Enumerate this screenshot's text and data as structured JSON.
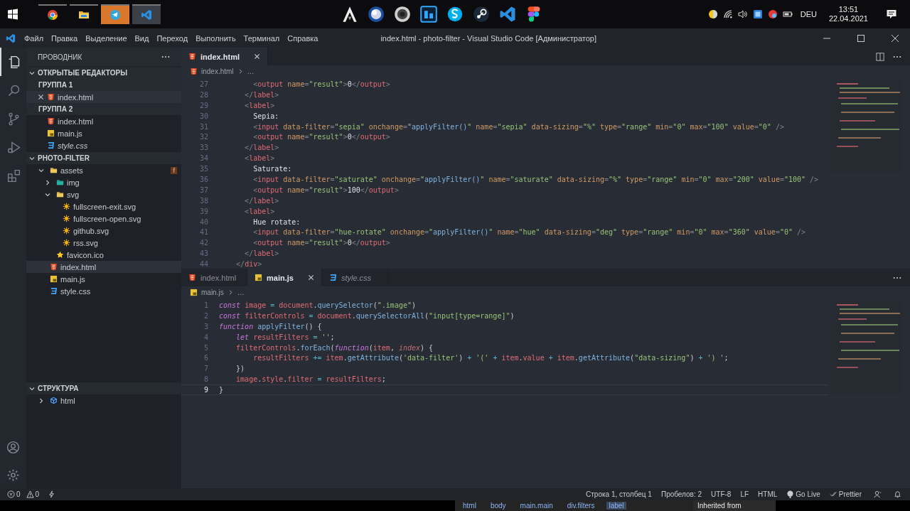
{
  "taskbar": {
    "left_apps": [
      {
        "kind": "start"
      },
      {
        "kind": "browser",
        "running": true,
        "attention": false,
        "active": false
      },
      {
        "kind": "folder",
        "running": true,
        "attention": false,
        "active": false
      },
      {
        "kind": "plane",
        "running": true,
        "attention": true,
        "active": false
      },
      {
        "kind": "editor",
        "running": true,
        "attention": false,
        "active": true
      }
    ],
    "pinned_apps": [
      {
        "kind": "peak"
      },
      {
        "kind": "sphere"
      },
      {
        "kind": "disc"
      },
      {
        "kind": "square"
      },
      {
        "kind": "bubble"
      },
      {
        "kind": "knob"
      },
      {
        "kind": "editor"
      },
      {
        "kind": "shapes"
      }
    ],
    "tray": {
      "icons": [
        {
          "kind": "weather"
        },
        {
          "kind": "wifi"
        },
        {
          "kind": "volume"
        },
        {
          "kind": "app"
        },
        {
          "kind": "ball"
        },
        {
          "kind": "battery"
        }
      ],
      "language": "DEU",
      "time": "13:51",
      "date": "22.04.2021"
    }
  },
  "window": {
    "menu": [
      "Файл",
      "Правка",
      "Выделение",
      "Вид",
      "Переход",
      "Выполнить",
      "Терминал",
      "Справка"
    ],
    "title": "index.html - photo-filter - Visual Studio Code [Администратор]"
  },
  "activity_bar": [
    {
      "kind": "explorer",
      "selected": true
    },
    {
      "kind": "search",
      "selected": false
    },
    {
      "kind": "source-control",
      "selected": false
    },
    {
      "kind": "run",
      "selected": false
    },
    {
      "kind": "extensions",
      "selected": false
    }
  ],
  "sidebar": {
    "title": "ПРОВОДНИК",
    "sections": [
      {
        "kind": "open-editors",
        "title": "ОТКРЫТЫЕ РЕДАКТОРЫ",
        "expanded": true,
        "groups": [
          {
            "title": "ГРУППА 1",
            "files": [
              {
                "name": "index.html",
                "kind": "html",
                "selected": true,
                "closable": true,
                "preview": false
              }
            ]
          },
          {
            "title": "ГРУППА 2",
            "files": [
              {
                "name": "index.html",
                "kind": "html",
                "selected": false,
                "closable": false,
                "preview": false
              },
              {
                "name": "main.js",
                "kind": "js",
                "selected": false,
                "closable": false,
                "preview": false
              },
              {
                "name": "style.css",
                "kind": "css",
                "selected": false,
                "closable": false,
                "preview": true
              }
            ]
          }
        ]
      },
      {
        "kind": "tree",
        "title": "PHOTO-FILTER",
        "expanded": true,
        "items": [
          {
            "name": "assets",
            "kind": "folder",
            "expanded": true,
            "selected": false,
            "badge": "f",
            "children": [
              {
                "name": "img",
                "kind": "image-folder",
                "expanded": false,
                "selected": false
              },
              {
                "name": "svg",
                "kind": "folder",
                "expanded": true,
                "selected": false,
                "children": [
                  {
                    "name": "fullscreen-exit.svg",
                    "kind": "svg",
                    "selected": false
                  },
                  {
                    "name": "fullscreen-open.svg",
                    "kind": "svg",
                    "selected": false
                  },
                  {
                    "name": "github.svg",
                    "kind": "svg",
                    "selected": false
                  },
                  {
                    "name": "rss.svg",
                    "kind": "svg",
                    "selected": false
                  }
                ]
              },
              {
                "name": "favicon.ico",
                "kind": "ico",
                "selected": false
              }
            ]
          },
          {
            "name": "index.html",
            "kind": "html",
            "selected": true
          },
          {
            "name": "main.js",
            "kind": "js",
            "selected": false
          },
          {
            "name": "style.css",
            "kind": "css",
            "selected": false
          }
        ]
      },
      {
        "kind": "outline",
        "title": "СТРУКТУРА",
        "expanded": true,
        "items": [
          {
            "name": "html",
            "kind": "element",
            "expanded": false,
            "selected": false
          }
        ]
      }
    ]
  },
  "editor_groups": [
    {
      "tabs": [
        {
          "name": "index.html",
          "kind": "html",
          "selected": true,
          "preview": false
        }
      ],
      "breadcrumb": {
        "file": "index.html",
        "kind": "html",
        "rest": "…"
      },
      "lines": [
        {
          "number": "27",
          "current": false,
          "tokens": [
            {
              "kind": "bracket",
              "t": "        <"
            },
            {
              "kind": "tag",
              "t": "output"
            },
            {
              "kind": "attr",
              "t": " name"
            },
            {
              "kind": "bracket",
              "t": "="
            },
            {
              "kind": "string",
              "t": "\"result\""
            },
            {
              "kind": "bracket",
              "t": ">"
            },
            {
              "kind": "text",
              "t": "0"
            },
            {
              "kind": "bracket",
              "t": "</"
            },
            {
              "kind": "tag",
              "t": "output"
            },
            {
              "kind": "bracket",
              "t": ">"
            }
          ]
        },
        {
          "number": "28",
          "current": false,
          "tokens": [
            {
              "kind": "bracket",
              "t": "      </"
            },
            {
              "kind": "tag",
              "t": "label"
            },
            {
              "kind": "bracket",
              "t": ">"
            }
          ]
        },
        {
          "number": "29",
          "current": false,
          "tokens": [
            {
              "kind": "bracket",
              "t": "      <"
            },
            {
              "kind": "tag",
              "t": "label"
            },
            {
              "kind": "bracket",
              "t": ">"
            }
          ]
        },
        {
          "number": "30",
          "current": false,
          "tokens": [
            {
              "kind": "text",
              "t": "        Sepia:"
            }
          ]
        },
        {
          "number": "31",
          "current": false,
          "tokens": [
            {
              "kind": "bracket",
              "t": "        <"
            },
            {
              "kind": "tag",
              "t": "input"
            },
            {
              "kind": "attr",
              "t": " data-filter"
            },
            {
              "kind": "bracket",
              "t": "="
            },
            {
              "kind": "string",
              "t": "\"sepia\""
            },
            {
              "kind": "attr",
              "t": " onchange"
            },
            {
              "kind": "bracket",
              "t": "="
            },
            {
              "kind": "string",
              "t": "\""
            },
            {
              "kind": "fn",
              "t": "applyFilter()"
            },
            {
              "kind": "string",
              "t": "\""
            },
            {
              "kind": "attr",
              "t": " name"
            },
            {
              "kind": "bracket",
              "t": "="
            },
            {
              "kind": "string",
              "t": "\"sepia\""
            },
            {
              "kind": "attr",
              "t": " data-sizing"
            },
            {
              "kind": "bracket",
              "t": "="
            },
            {
              "kind": "string",
              "t": "\"%\""
            },
            {
              "kind": "attr",
              "t": " type"
            },
            {
              "kind": "bracket",
              "t": "="
            },
            {
              "kind": "string",
              "t": "\"range\""
            },
            {
              "kind": "attr",
              "t": " min"
            },
            {
              "kind": "bracket",
              "t": "="
            },
            {
              "kind": "string",
              "t": "\"0\""
            },
            {
              "kind": "attr",
              "t": " max"
            },
            {
              "kind": "bracket",
              "t": "="
            },
            {
              "kind": "string",
              "t": "\"100\""
            },
            {
              "kind": "attr",
              "t": " value"
            },
            {
              "kind": "bracket",
              "t": "="
            },
            {
              "kind": "string",
              "t": "\"0\""
            },
            {
              "kind": "bracket",
              "t": " />"
            }
          ]
        },
        {
          "number": "32",
          "current": false,
          "tokens": [
            {
              "kind": "bracket",
              "t": "        <"
            },
            {
              "kind": "tag",
              "t": "output"
            },
            {
              "kind": "attr",
              "t": " name"
            },
            {
              "kind": "bracket",
              "t": "="
            },
            {
              "kind": "string",
              "t": "\"result\""
            },
            {
              "kind": "bracket",
              "t": ">"
            },
            {
              "kind": "text",
              "t": "0"
            },
            {
              "kind": "bracket",
              "t": "</"
            },
            {
              "kind": "tag",
              "t": "output"
            },
            {
              "kind": "bracket",
              "t": ">"
            }
          ]
        },
        {
          "number": "33",
          "current": false,
          "tokens": [
            {
              "kind": "bracket",
              "t": "      </"
            },
            {
              "kind": "tag",
              "t": "label"
            },
            {
              "kind": "bracket",
              "t": ">"
            }
          ]
        },
        {
          "number": "34",
          "current": false,
          "tokens": [
            {
              "kind": "bracket",
              "t": "      <"
            },
            {
              "kind": "tag",
              "t": "label"
            },
            {
              "kind": "bracket",
              "t": ">"
            }
          ]
        },
        {
          "number": "35",
          "current": false,
          "tokens": [
            {
              "kind": "text",
              "t": "        Saturate:"
            }
          ]
        },
        {
          "number": "36",
          "current": false,
          "tokens": [
            {
              "kind": "bracket",
              "t": "        <"
            },
            {
              "kind": "tag",
              "t": "input"
            },
            {
              "kind": "attr",
              "t": " data-filter"
            },
            {
              "kind": "bracket",
              "t": "="
            },
            {
              "kind": "string",
              "t": "\"saturate\""
            },
            {
              "kind": "attr",
              "t": " onchange"
            },
            {
              "kind": "bracket",
              "t": "="
            },
            {
              "kind": "string",
              "t": "\""
            },
            {
              "kind": "fn",
              "t": "applyFilter()"
            },
            {
              "kind": "string",
              "t": "\""
            },
            {
              "kind": "attr",
              "t": " name"
            },
            {
              "kind": "bracket",
              "t": "="
            },
            {
              "kind": "string",
              "t": "\"saturate\""
            },
            {
              "kind": "attr",
              "t": " data-sizing"
            },
            {
              "kind": "bracket",
              "t": "="
            },
            {
              "kind": "string",
              "t": "\"%\""
            },
            {
              "kind": "attr",
              "t": " type"
            },
            {
              "kind": "bracket",
              "t": "="
            },
            {
              "kind": "string",
              "t": "\"range\""
            },
            {
              "kind": "attr",
              "t": " min"
            },
            {
              "kind": "bracket",
              "t": "="
            },
            {
              "kind": "string",
              "t": "\"0\""
            },
            {
              "kind": "attr",
              "t": " max"
            },
            {
              "kind": "bracket",
              "t": "="
            },
            {
              "kind": "string",
              "t": "\"200\""
            },
            {
              "kind": "attr",
              "t": " value"
            },
            {
              "kind": "bracket",
              "t": "="
            },
            {
              "kind": "string",
              "t": "\"100\""
            },
            {
              "kind": "bracket",
              "t": " />"
            }
          ]
        },
        {
          "number": "37",
          "current": false,
          "tokens": [
            {
              "kind": "bracket",
              "t": "        <"
            },
            {
              "kind": "tag",
              "t": "output"
            },
            {
              "kind": "attr",
              "t": " name"
            },
            {
              "kind": "bracket",
              "t": "="
            },
            {
              "kind": "string",
              "t": "\"result\""
            },
            {
              "kind": "bracket",
              "t": ">"
            },
            {
              "kind": "text",
              "t": "100"
            },
            {
              "kind": "bracket",
              "t": "</"
            },
            {
              "kind": "tag",
              "t": "output"
            },
            {
              "kind": "bracket",
              "t": ">"
            }
          ]
        },
        {
          "number": "38",
          "current": false,
          "tokens": [
            {
              "kind": "bracket",
              "t": "      </"
            },
            {
              "kind": "tag",
              "t": "label"
            },
            {
              "kind": "bracket",
              "t": ">"
            }
          ]
        },
        {
          "number": "39",
          "current": false,
          "tokens": [
            {
              "kind": "bracket",
              "t": "      <"
            },
            {
              "kind": "tag",
              "t": "label"
            },
            {
              "kind": "bracket",
              "t": ">"
            }
          ]
        },
        {
          "number": "40",
          "current": false,
          "tokens": [
            {
              "kind": "text",
              "t": "        Hue rotate:"
            }
          ]
        },
        {
          "number": "41",
          "current": false,
          "tokens": [
            {
              "kind": "bracket",
              "t": "        <"
            },
            {
              "kind": "tag",
              "t": "input"
            },
            {
              "kind": "attr",
              "t": " data-filter"
            },
            {
              "kind": "bracket",
              "t": "="
            },
            {
              "kind": "string",
              "t": "\"hue-rotate\""
            },
            {
              "kind": "attr",
              "t": " onchange"
            },
            {
              "kind": "bracket",
              "t": "="
            },
            {
              "kind": "string",
              "t": "\""
            },
            {
              "kind": "fn",
              "t": "applyFilter()"
            },
            {
              "kind": "string",
              "t": "\""
            },
            {
              "kind": "attr",
              "t": " name"
            },
            {
              "kind": "bracket",
              "t": "="
            },
            {
              "kind": "string",
              "t": "\"hue\""
            },
            {
              "kind": "attr",
              "t": " data-sizing"
            },
            {
              "kind": "bracket",
              "t": "="
            },
            {
              "kind": "string",
              "t": "\"deg\""
            },
            {
              "kind": "attr",
              "t": " type"
            },
            {
              "kind": "bracket",
              "t": "="
            },
            {
              "kind": "string",
              "t": "\"range\""
            },
            {
              "kind": "attr",
              "t": " min"
            },
            {
              "kind": "bracket",
              "t": "="
            },
            {
              "kind": "string",
              "t": "\"0\""
            },
            {
              "kind": "attr",
              "t": " max"
            },
            {
              "kind": "bracket",
              "t": "="
            },
            {
              "kind": "string",
              "t": "\"360\""
            },
            {
              "kind": "attr",
              "t": " value"
            },
            {
              "kind": "bracket",
              "t": "="
            },
            {
              "kind": "string",
              "t": "\"0\""
            },
            {
              "kind": "bracket",
              "t": " />"
            }
          ]
        },
        {
          "number": "42",
          "current": false,
          "tokens": [
            {
              "kind": "bracket",
              "t": "        <"
            },
            {
              "kind": "tag",
              "t": "output"
            },
            {
              "kind": "attr",
              "t": " name"
            },
            {
              "kind": "bracket",
              "t": "="
            },
            {
              "kind": "string",
              "t": "\"result\""
            },
            {
              "kind": "bracket",
              "t": ">"
            },
            {
              "kind": "text",
              "t": "0"
            },
            {
              "kind": "bracket",
              "t": "</"
            },
            {
              "kind": "tag",
              "t": "output"
            },
            {
              "kind": "bracket",
              "t": ">"
            }
          ]
        },
        {
          "number": "43",
          "current": false,
          "tokens": [
            {
              "kind": "bracket",
              "t": "      </"
            },
            {
              "kind": "tag",
              "t": "label"
            },
            {
              "kind": "bracket",
              "t": ">"
            }
          ]
        },
        {
          "number": "44",
          "current": false,
          "tokens": [
            {
              "kind": "bracket",
              "t": "    </"
            },
            {
              "kind": "tag",
              "t": "div"
            },
            {
              "kind": "bracket",
              "t": ">"
            }
          ]
        }
      ]
    },
    {
      "tabs": [
        {
          "name": "index.html",
          "kind": "html",
          "selected": false,
          "preview": false
        },
        {
          "name": "main.js",
          "kind": "js",
          "selected": true,
          "preview": false
        },
        {
          "name": "style.css",
          "kind": "css",
          "selected": false,
          "preview": true
        }
      ],
      "breadcrumb": {
        "file": "main.js",
        "kind": "js",
        "rest": "…"
      },
      "lines": [
        {
          "number": "1",
          "current": false,
          "tokens": [
            {
              "kind": "keyword",
              "t": "const"
            },
            {
              "kind": "variable",
              "t": " image"
            },
            {
              "kind": "op",
              "t": " = "
            },
            {
              "kind": "variable",
              "t": "document"
            },
            {
              "kind": "punct",
              "t": "."
            },
            {
              "kind": "fn",
              "t": "querySelector"
            },
            {
              "kind": "punct",
              "t": "("
            },
            {
              "kind": "string",
              "t": "\".image\""
            },
            {
              "kind": "punct",
              "t": ")"
            }
          ]
        },
        {
          "number": "2",
          "current": false,
          "tokens": [
            {
              "kind": "keyword",
              "t": "const"
            },
            {
              "kind": "variable",
              "t": " filterControls"
            },
            {
              "kind": "op",
              "t": " = "
            },
            {
              "kind": "variable",
              "t": "document"
            },
            {
              "kind": "punct",
              "t": "."
            },
            {
              "kind": "fn",
              "t": "querySelectorAll"
            },
            {
              "kind": "punct",
              "t": "("
            },
            {
              "kind": "string",
              "t": "\"input[type=range]\""
            },
            {
              "kind": "punct",
              "t": ")"
            }
          ]
        },
        {
          "number": "3",
          "current": false,
          "tokens": [
            {
              "kind": "keyword",
              "t": "function"
            },
            {
              "kind": "fn",
              "t": " applyFilter"
            },
            {
              "kind": "punct",
              "t": "() {"
            }
          ]
        },
        {
          "number": "4",
          "current": false,
          "tokens": [
            {
              "kind": "keyword",
              "t": "    let"
            },
            {
              "kind": "variable",
              "t": " resultFilters"
            },
            {
              "kind": "op",
              "t": " = "
            },
            {
              "kind": "string",
              "t": "''"
            },
            {
              "kind": "punct",
              "t": ";"
            }
          ]
        },
        {
          "number": "5",
          "current": false,
          "tokens": [
            {
              "kind": "variable",
              "t": "    filterControls"
            },
            {
              "kind": "punct",
              "t": "."
            },
            {
              "kind": "fn",
              "t": "forEach"
            },
            {
              "kind": "punct",
              "t": "("
            },
            {
              "kind": "keyword",
              "t": "function"
            },
            {
              "kind": "punct",
              "t": "("
            },
            {
              "kind": "variable",
              "t": "item"
            },
            {
              "kind": "punct",
              "t": ", "
            },
            {
              "kind": "param",
              "t": "index"
            },
            {
              "kind": "punct",
              "t": ") {"
            }
          ]
        },
        {
          "number": "6",
          "current": false,
          "tokens": [
            {
              "kind": "variable",
              "t": "        resultFilters"
            },
            {
              "kind": "op",
              "t": " += "
            },
            {
              "kind": "variable",
              "t": "item"
            },
            {
              "kind": "punct",
              "t": "."
            },
            {
              "kind": "fn",
              "t": "getAttribute"
            },
            {
              "kind": "punct",
              "t": "("
            },
            {
              "kind": "string",
              "t": "'data-filter'"
            },
            {
              "kind": "punct",
              "t": ")"
            },
            {
              "kind": "op",
              "t": " + "
            },
            {
              "kind": "string",
              "t": "'('"
            },
            {
              "kind": "op",
              "t": " + "
            },
            {
              "kind": "variable",
              "t": "item"
            },
            {
              "kind": "punct",
              "t": "."
            },
            {
              "kind": "variable",
              "t": "value"
            },
            {
              "kind": "op",
              "t": " + "
            },
            {
              "kind": "variable",
              "t": "item"
            },
            {
              "kind": "punct",
              "t": "."
            },
            {
              "kind": "fn",
              "t": "getAttribute"
            },
            {
              "kind": "punct",
              "t": "("
            },
            {
              "kind": "string",
              "t": "\"data-sizing\""
            },
            {
              "kind": "punct",
              "t": ")"
            },
            {
              "kind": "op",
              "t": " + "
            },
            {
              "kind": "string",
              "t": "') '"
            },
            {
              "kind": "punct",
              "t": ";"
            }
          ]
        },
        {
          "number": "7",
          "current": false,
          "tokens": [
            {
              "kind": "punct",
              "t": "    })"
            }
          ]
        },
        {
          "number": "8",
          "current": false,
          "tokens": [
            {
              "kind": "variable",
              "t": "    image"
            },
            {
              "kind": "punct",
              "t": "."
            },
            {
              "kind": "variable",
              "t": "style"
            },
            {
              "kind": "punct",
              "t": "."
            },
            {
              "kind": "variable",
              "t": "filter"
            },
            {
              "kind": "op",
              "t": " = "
            },
            {
              "kind": "variable",
              "t": "resultFilters"
            },
            {
              "kind": "punct",
              "t": ";"
            }
          ]
        },
        {
          "number": "9",
          "current": true,
          "tokens": [
            {
              "kind": "punct",
              "t": "}"
            }
          ]
        }
      ]
    }
  ],
  "status_bar": {
    "left": [
      {
        "kind": "errors",
        "text": "0"
      },
      {
        "kind": "warnings",
        "text": "0"
      },
      {
        "kind": "plug"
      }
    ],
    "right": [
      {
        "kind": "text",
        "text": "Строка 1, столбец 1"
      },
      {
        "kind": "text",
        "text": "Пробелов: 2"
      },
      {
        "kind": "text",
        "text": "UTF-8"
      },
      {
        "kind": "text",
        "text": "LF"
      },
      {
        "kind": "text",
        "text": "HTML"
      },
      {
        "kind": "golive",
        "text": "Go Live"
      },
      {
        "kind": "prettier",
        "text": "Prettier"
      },
      {
        "kind": "feedback"
      },
      {
        "kind": "bell"
      }
    ]
  },
  "background_window": {
    "crumbs": [
      {
        "text": "html",
        "selected": false
      },
      {
        "text": "body",
        "selected": false
      },
      {
        "text": "main.main",
        "selected": false
      },
      {
        "text": "div.filters",
        "selected": false
      },
      {
        "text": "label",
        "selected": true
      }
    ],
    "panel": "Inherited from"
  }
}
